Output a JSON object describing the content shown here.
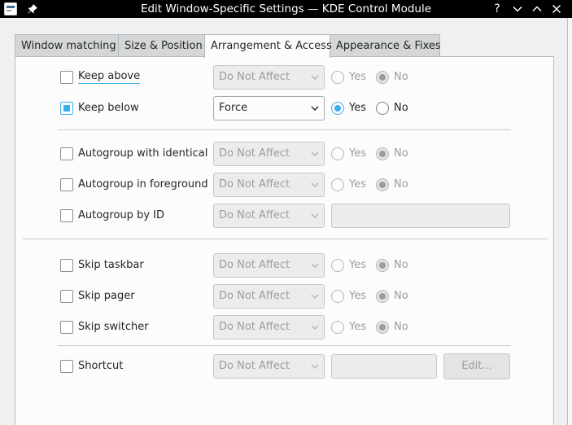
{
  "window": {
    "title": "Edit Window-Specific Settings — KDE Control Module",
    "help_glyph": "?"
  },
  "tabs": [
    {
      "label": "Window matching",
      "active": false
    },
    {
      "label": "Size & Position",
      "active": false
    },
    {
      "label": "Arrangement & Access",
      "active": true
    },
    {
      "label": "Appearance & Fixes",
      "active": false
    }
  ],
  "rows": {
    "keep_above": {
      "label": "Keep above",
      "checked": false,
      "policy": "Do Not Affect",
      "yes": "Yes",
      "no": "No",
      "selected": "no"
    },
    "keep_below": {
      "label": "Keep below",
      "checked": true,
      "policy": "Force",
      "yes": "Yes",
      "no": "No",
      "selected": "yes"
    },
    "autogroup_identical": {
      "label": "Autogroup with identical",
      "checked": false,
      "policy": "Do Not Affect",
      "yes": "Yes",
      "no": "No",
      "selected": "no"
    },
    "autogroup_foreground": {
      "label": "Autogroup in foreground",
      "checked": false,
      "policy": "Do Not Affect",
      "yes": "Yes",
      "no": "No",
      "selected": "no"
    },
    "autogroup_id": {
      "label": "Autogroup by ID",
      "checked": false,
      "policy": "Do Not Affect",
      "value": ""
    },
    "skip_taskbar": {
      "label": "Skip taskbar",
      "checked": false,
      "policy": "Do Not Affect",
      "yes": "Yes",
      "no": "No",
      "selected": "no"
    },
    "skip_pager": {
      "label": "Skip pager",
      "checked": false,
      "policy": "Do Not Affect",
      "yes": "Yes",
      "no": "No",
      "selected": "no"
    },
    "skip_switcher": {
      "label": "Skip switcher",
      "checked": false,
      "policy": "Do Not Affect",
      "yes": "Yes",
      "no": "No",
      "selected": "no"
    },
    "shortcut": {
      "label": "Shortcut",
      "checked": false,
      "policy": "Do Not Affect",
      "value": "",
      "edit_label": "Edit..."
    }
  },
  "colors": {
    "accent": "#3daee9",
    "titlebar": "#000000",
    "window_bg": "#eff0f1",
    "panel_bg": "#fcfcfc"
  }
}
